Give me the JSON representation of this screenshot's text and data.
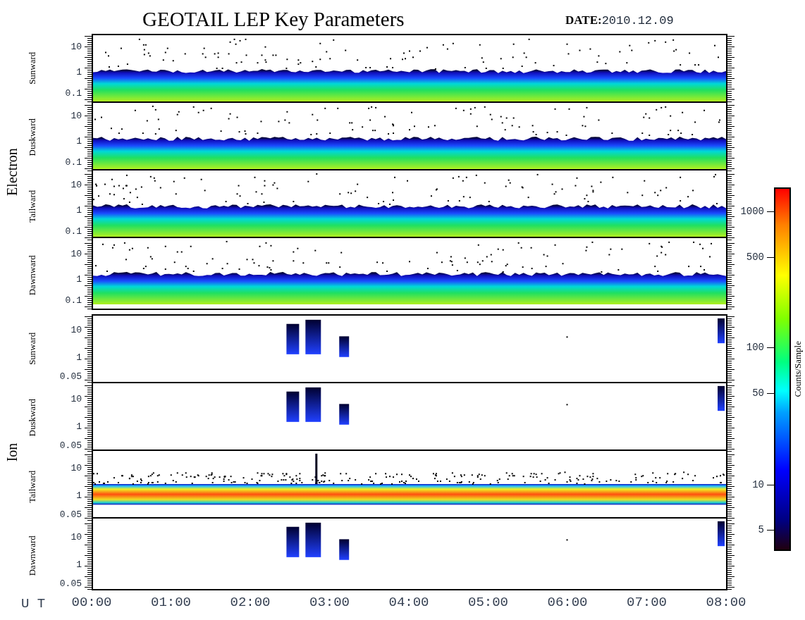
{
  "title": "GEOTAIL LEP Key Parameters",
  "date": {
    "label": "DATE:",
    "value": "2010.12.09"
  },
  "groups": [
    {
      "species": "Electron",
      "panels": [
        {
          "direction": "Sunward",
          "kind": "band",
          "yticks": [
            "10",
            "1",
            "0.1"
          ]
        },
        {
          "direction": "Duskward",
          "kind": "band",
          "yticks": [
            "10",
            "1",
            "0.1"
          ]
        },
        {
          "direction": "Tailward",
          "kind": "band",
          "yticks": [
            "10",
            "1",
            "0.1"
          ]
        },
        {
          "direction": "Dawnward",
          "kind": "band",
          "yticks": [
            "10",
            "1",
            "0.1"
          ]
        }
      ]
    },
    {
      "species": "Ion",
      "panels": [
        {
          "direction": "Sunward",
          "kind": "bursts",
          "yticks": [
            "10",
            "1",
            "0.05"
          ]
        },
        {
          "direction": "Duskward",
          "kind": "bursts",
          "yticks": [
            "10",
            "1",
            "0.05"
          ]
        },
        {
          "direction": "Tailward",
          "kind": "hot-band",
          "yticks": [
            "10",
            "1",
            "0.05"
          ]
        },
        {
          "direction": "Dawnward",
          "kind": "bursts",
          "yticks": [
            "10",
            "1",
            "0.05"
          ]
        }
      ]
    }
  ],
  "x_axis": {
    "label": "U T",
    "ticks": [
      "00:00",
      "01:00",
      "02:00",
      "03:00",
      "04:00",
      "05:00",
      "06:00",
      "07:00",
      "08:00"
    ]
  },
  "colorbar": {
    "label": "Counts/Sample",
    "ticks": [
      "1000",
      "500",
      "100",
      "50",
      "10",
      "5"
    ]
  }
}
